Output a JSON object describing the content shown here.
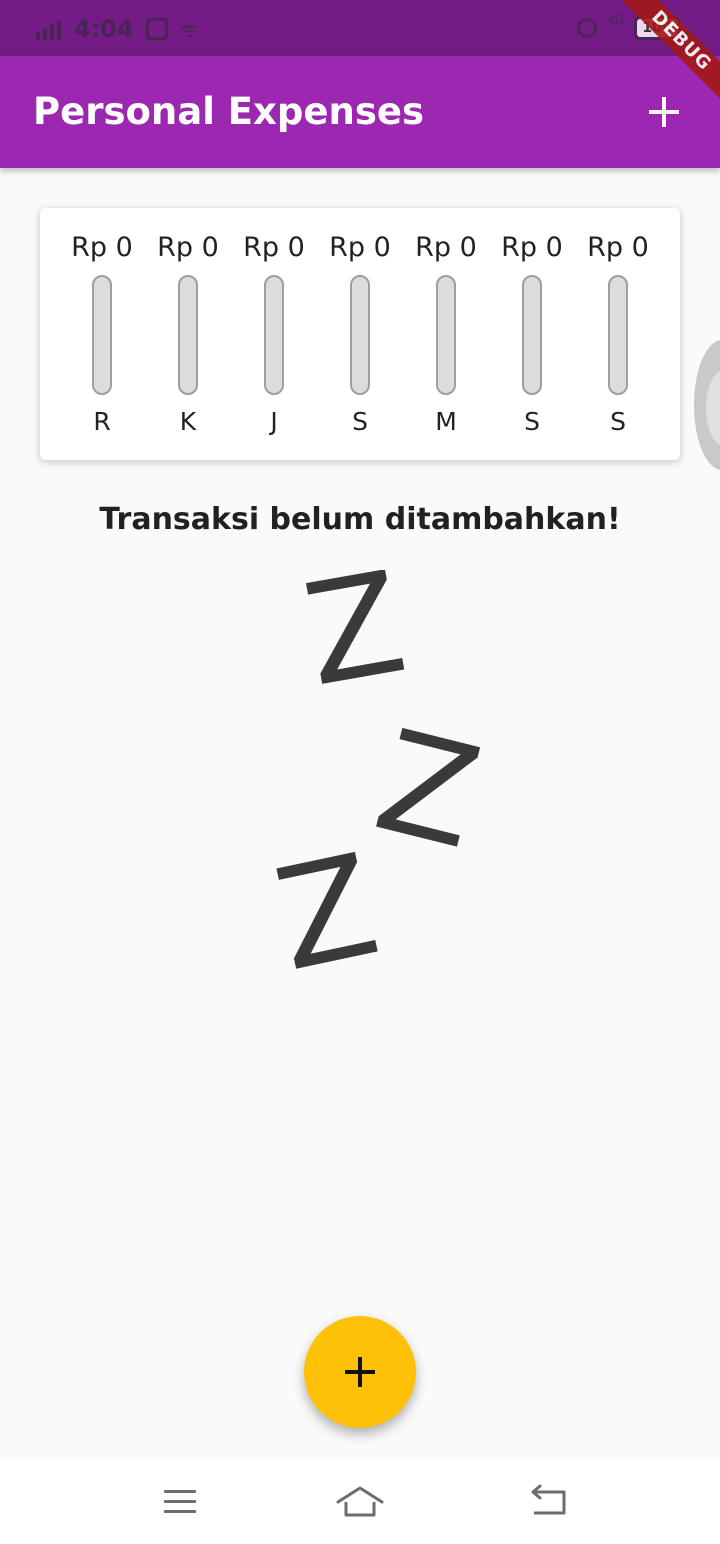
{
  "status_bar": {
    "time": "4:04",
    "network": "4G",
    "battery": "100"
  },
  "debug_banner": "DEBUG",
  "app_bar": {
    "title": "Personal Expenses"
  },
  "chart": {
    "columns": [
      {
        "amount": "Rp 0",
        "day": "R",
        "fill": 0
      },
      {
        "amount": "Rp 0",
        "day": "K",
        "fill": 0
      },
      {
        "amount": "Rp 0",
        "day": "J",
        "fill": 0
      },
      {
        "amount": "Rp 0",
        "day": "S",
        "fill": 0
      },
      {
        "amount": "Rp 0",
        "day": "M",
        "fill": 0
      },
      {
        "amount": "Rp 0",
        "day": "S",
        "fill": 0
      },
      {
        "amount": "Rp 0",
        "day": "S",
        "fill": 0
      }
    ]
  },
  "empty_state": {
    "message": "Transaksi belum ditambahkan!",
    "image_letters": [
      "Z",
      "Z",
      "Z"
    ]
  },
  "colors": {
    "primary": "#9c27b0",
    "accent": "#ffc107",
    "status_bar": "#731c85"
  },
  "icons": {
    "appbar_action": "plus-icon",
    "fab": "plus-icon",
    "nav_menu": "menu-icon",
    "nav_home": "home-icon",
    "nav_back": "back-icon"
  }
}
